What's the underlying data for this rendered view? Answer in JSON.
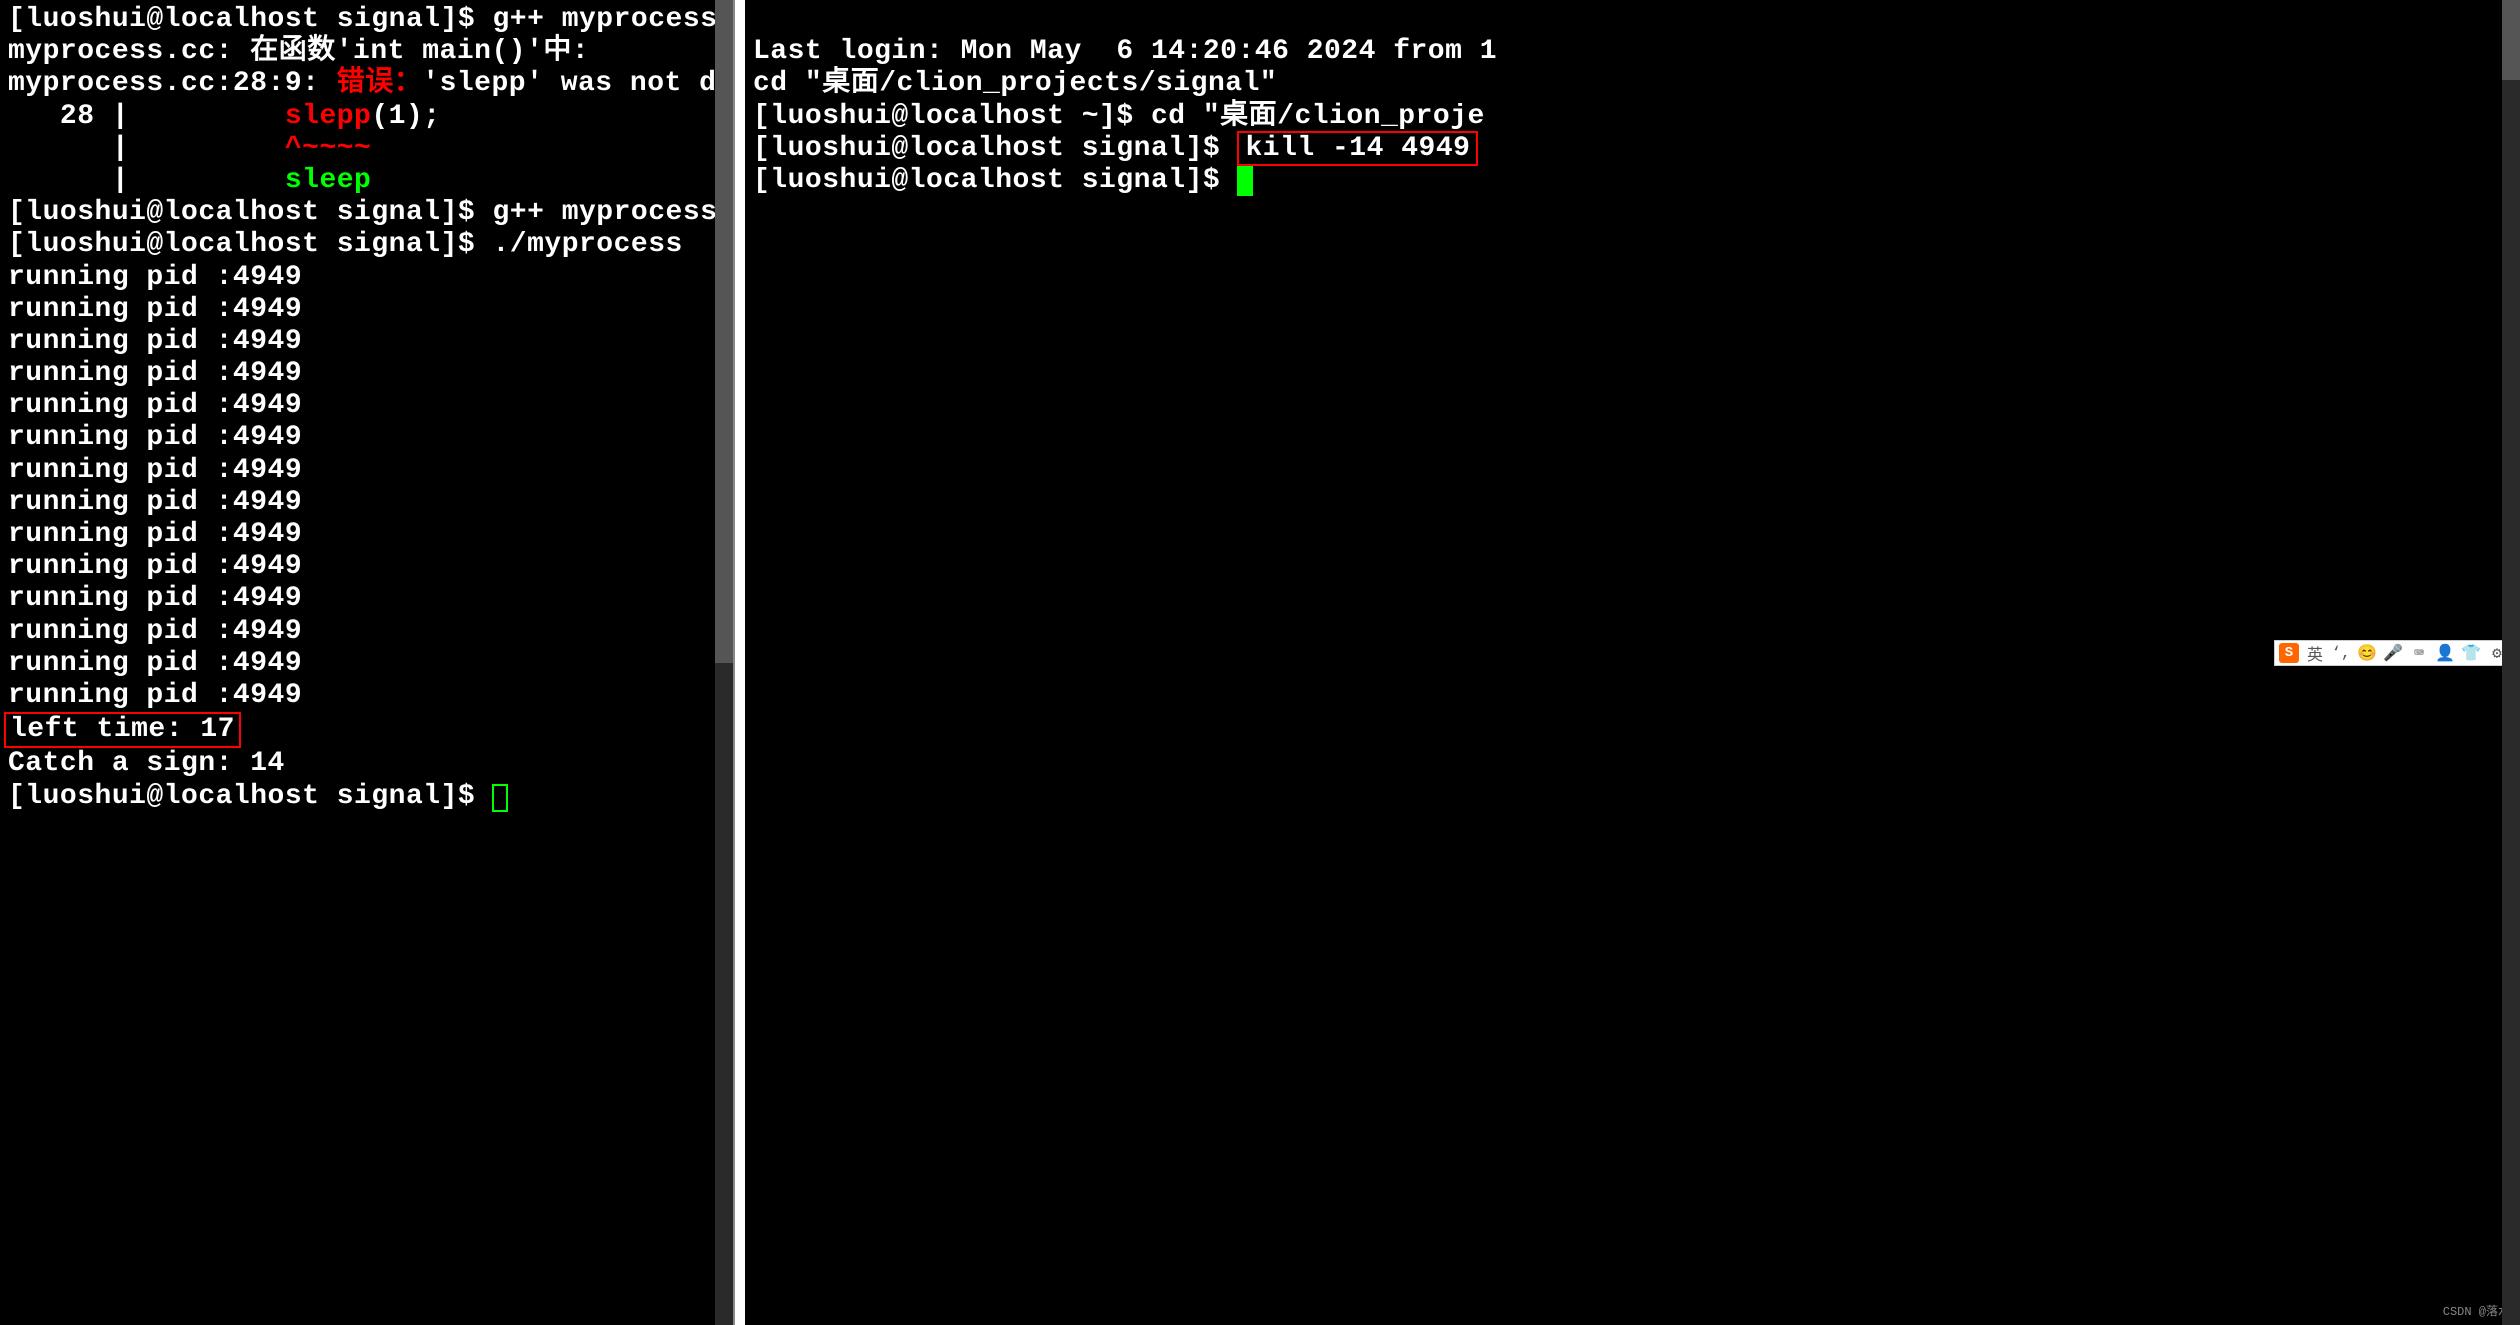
{
  "left": {
    "prompt_prefix": "[luoshui@localhost signal]$ ",
    "cmd1": "g++ myprocess.c",
    "err_file": "myprocess.cc:",
    "err_func_pre": " 在函数'",
    "err_func": "int main()",
    "err_func_post": "'中:",
    "err_loc": "myprocess.cc:28:9:",
    "err_label": " 错误：",
    "err_msg_pre": "'",
    "err_token": "slepp",
    "err_msg_post": "' was not de",
    "err_line_num": "   28 |         ",
    "err_code": "slepp",
    "err_code_post": "(1);",
    "err_pipe": "      |         ",
    "err_caret": "^~~~~",
    "err_suggest": "sleep",
    "cmd2": "g++ myprocess.c",
    "cmd3": "./myprocess",
    "running_lines": [
      "running pid :4949",
      "running pid :4949",
      "running pid :4949",
      "running pid :4949",
      "running pid :4949",
      "running pid :4949",
      "running pid :4949",
      "running pid :4949",
      "running pid :4949",
      "running pid :4949",
      "running pid :4949",
      "running pid :4949",
      "running pid :4949",
      "running pid :4949"
    ],
    "left_time": "left time: 17",
    "catch_sign": "Catch a sign: 14"
  },
  "right": {
    "last_login": "Last login: Mon May  6 14:20:46 2024 from 1",
    "cd_line": "cd \"桌面/clion_projects/signal\"",
    "prompt_home": "[luoshui@localhost ~]$ ",
    "cmd_cd": "cd \"桌面/clion_proje",
    "prompt_signal": "[luoshui@localhost signal]$ ",
    "kill_cmd": "kill -14 4949"
  },
  "ime": {
    "logo": "S",
    "lang": "英",
    "punct": "‘,",
    "icons": [
      "😊",
      "🎤",
      "⌨",
      "👤",
      "👕",
      "⚙"
    ]
  },
  "watermark": "CSDN @落水"
}
